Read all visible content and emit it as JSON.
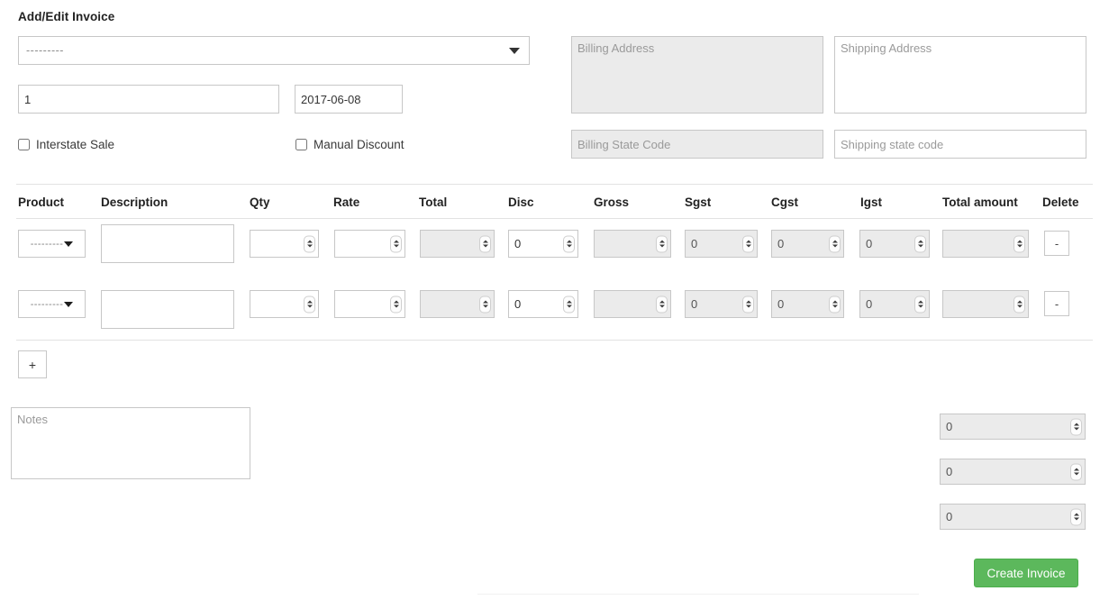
{
  "page": {
    "title": "Add/Edit Invoice"
  },
  "customer_select": {
    "placeholder": "---------",
    "icon": "caret-down-icon"
  },
  "invoice": {
    "number_value": "1",
    "number_placeholder": "",
    "date_value": "2017-06-08",
    "date_placeholder": ""
  },
  "options": {
    "interstate_sale_label": "Interstate Sale",
    "interstate_sale_checked": false,
    "manual_discount_label": "Manual Discount",
    "manual_discount_checked": false
  },
  "addresses": {
    "billing_address_placeholder": "Billing Address",
    "billing_address_value": "",
    "billing_address_disabled": true,
    "shipping_address_placeholder": "Shipping Address",
    "shipping_address_value": "",
    "shipping_address_disabled": false,
    "billing_state_placeholder": "Billing State Code",
    "billing_state_value": "",
    "billing_state_disabled": true,
    "shipping_state_placeholder": "Shipping state code",
    "shipping_state_value": "",
    "shipping_state_disabled": false
  },
  "line_items_table": {
    "columns": [
      "Product",
      "Description",
      "Qty",
      "Rate",
      "Total",
      "Disc",
      "Gross",
      "Sgst",
      "Cgst",
      "Igst",
      "Total amount",
      "Delete"
    ],
    "product_placeholder": "---------",
    "delete_label": "-",
    "rows": [
      {
        "product": "---------",
        "description": "",
        "qty": "",
        "rate": "",
        "total": "",
        "disc": "0",
        "gross": "",
        "sgst": "0",
        "cgst": "0",
        "igst": "0",
        "total_amount": "",
        "delete": "-"
      },
      {
        "product": "---------",
        "description": "",
        "qty": "",
        "rate": "",
        "total": "",
        "disc": "0",
        "gross": "",
        "sgst": "0",
        "cgst": "0",
        "igst": "0",
        "total_amount": "",
        "delete": "-"
      }
    ]
  },
  "add_row_button": {
    "label": "+"
  },
  "notes": {
    "placeholder": "Notes",
    "value": ""
  },
  "totals": {
    "line1_value": "0",
    "line2_value": "0",
    "line3_value": "0"
  },
  "submit": {
    "label": "Create Invoice",
    "color": "#5cb85c"
  },
  "colors": {
    "field_border": "#c7c7c7",
    "disabled_bg": "#ebebeb",
    "divider": "#e2e2e2",
    "text": "#333333",
    "placeholder": "#9a9a9a",
    "accent_green": "#5cb85c"
  }
}
